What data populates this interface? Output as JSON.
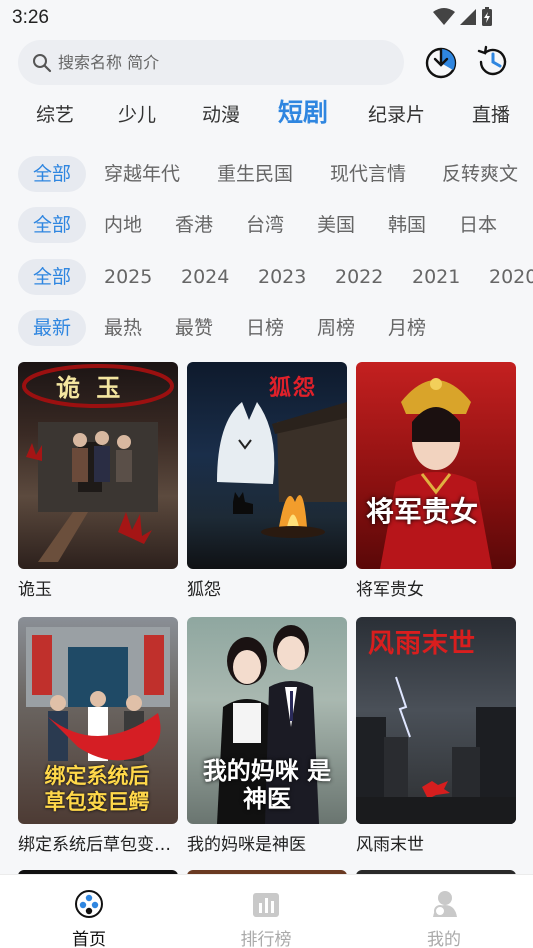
{
  "status_bar": {
    "time": "3:26"
  },
  "search": {
    "placeholder": "搜索名称 简介"
  },
  "categories": [
    "综艺",
    "少儿",
    "动漫",
    "短剧",
    "纪录片",
    "直播"
  ],
  "active_category": "短剧",
  "filters": {
    "genre": [
      "全部",
      "穿越年代",
      "重生民国",
      "现代言情",
      "反转爽文"
    ],
    "region": [
      "全部",
      "内地",
      "香港",
      "台湾",
      "美国",
      "韩国",
      "日本"
    ],
    "year": [
      "全部",
      "2025",
      "2024",
      "2023",
      "2022",
      "2021",
      "2020"
    ],
    "sort": [
      "最新",
      "最热",
      "最赞",
      "日榜",
      "周榜",
      "月榜"
    ]
  },
  "cards": [
    {
      "title": "诡玉",
      "poster_text": "诡 玉"
    },
    {
      "title": "狐怨",
      "poster_text": "狐怨"
    },
    {
      "title": "将军贵女",
      "poster_text": "将军贵女"
    },
    {
      "title": "绑定系统后草包变巨鳄",
      "poster_text": "绑定系统后 草包变巨鳄"
    },
    {
      "title": "我的妈咪是神医",
      "poster_text": "我的妈咪 是神医"
    },
    {
      "title": "风雨末世",
      "poster_text": "风雨末世"
    }
  ],
  "bottom_nav": [
    {
      "label": "首页",
      "active": true
    },
    {
      "label": "排行榜",
      "active": false
    },
    {
      "label": "我的",
      "active": false
    }
  ],
  "colors": {
    "accent": "#2f86e0",
    "chip_bg": "#e7eaf0",
    "inactive": "#999999"
  }
}
